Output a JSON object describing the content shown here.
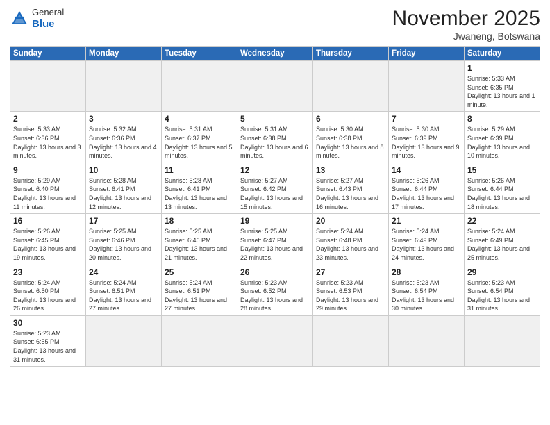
{
  "header": {
    "logo_general": "General",
    "logo_blue": "Blue",
    "month_title": "November 2025",
    "location": "Jwaneng, Botswana"
  },
  "days_of_week": [
    "Sunday",
    "Monday",
    "Tuesday",
    "Wednesday",
    "Thursday",
    "Friday",
    "Saturday"
  ],
  "weeks": [
    [
      {
        "day": "",
        "info": ""
      },
      {
        "day": "",
        "info": ""
      },
      {
        "day": "",
        "info": ""
      },
      {
        "day": "",
        "info": ""
      },
      {
        "day": "",
        "info": ""
      },
      {
        "day": "",
        "info": ""
      },
      {
        "day": "1",
        "info": "Sunrise: 5:33 AM\nSunset: 6:35 PM\nDaylight: 13 hours and 1 minute."
      }
    ],
    [
      {
        "day": "2",
        "info": "Sunrise: 5:33 AM\nSunset: 6:36 PM\nDaylight: 13 hours and 3 minutes."
      },
      {
        "day": "3",
        "info": "Sunrise: 5:32 AM\nSunset: 6:36 PM\nDaylight: 13 hours and 4 minutes."
      },
      {
        "day": "4",
        "info": "Sunrise: 5:31 AM\nSunset: 6:37 PM\nDaylight: 13 hours and 5 minutes."
      },
      {
        "day": "5",
        "info": "Sunrise: 5:31 AM\nSunset: 6:38 PM\nDaylight: 13 hours and 6 minutes."
      },
      {
        "day": "6",
        "info": "Sunrise: 5:30 AM\nSunset: 6:38 PM\nDaylight: 13 hours and 8 minutes."
      },
      {
        "day": "7",
        "info": "Sunrise: 5:30 AM\nSunset: 6:39 PM\nDaylight: 13 hours and 9 minutes."
      },
      {
        "day": "8",
        "info": "Sunrise: 5:29 AM\nSunset: 6:39 PM\nDaylight: 13 hours and 10 minutes."
      }
    ],
    [
      {
        "day": "9",
        "info": "Sunrise: 5:29 AM\nSunset: 6:40 PM\nDaylight: 13 hours and 11 minutes."
      },
      {
        "day": "10",
        "info": "Sunrise: 5:28 AM\nSunset: 6:41 PM\nDaylight: 13 hours and 12 minutes."
      },
      {
        "day": "11",
        "info": "Sunrise: 5:28 AM\nSunset: 6:41 PM\nDaylight: 13 hours and 13 minutes."
      },
      {
        "day": "12",
        "info": "Sunrise: 5:27 AM\nSunset: 6:42 PM\nDaylight: 13 hours and 15 minutes."
      },
      {
        "day": "13",
        "info": "Sunrise: 5:27 AM\nSunset: 6:43 PM\nDaylight: 13 hours and 16 minutes."
      },
      {
        "day": "14",
        "info": "Sunrise: 5:26 AM\nSunset: 6:44 PM\nDaylight: 13 hours and 17 minutes."
      },
      {
        "day": "15",
        "info": "Sunrise: 5:26 AM\nSunset: 6:44 PM\nDaylight: 13 hours and 18 minutes."
      }
    ],
    [
      {
        "day": "16",
        "info": "Sunrise: 5:26 AM\nSunset: 6:45 PM\nDaylight: 13 hours and 19 minutes."
      },
      {
        "day": "17",
        "info": "Sunrise: 5:25 AM\nSunset: 6:46 PM\nDaylight: 13 hours and 20 minutes."
      },
      {
        "day": "18",
        "info": "Sunrise: 5:25 AM\nSunset: 6:46 PM\nDaylight: 13 hours and 21 minutes."
      },
      {
        "day": "19",
        "info": "Sunrise: 5:25 AM\nSunset: 6:47 PM\nDaylight: 13 hours and 22 minutes."
      },
      {
        "day": "20",
        "info": "Sunrise: 5:24 AM\nSunset: 6:48 PM\nDaylight: 13 hours and 23 minutes."
      },
      {
        "day": "21",
        "info": "Sunrise: 5:24 AM\nSunset: 6:49 PM\nDaylight: 13 hours and 24 minutes."
      },
      {
        "day": "22",
        "info": "Sunrise: 5:24 AM\nSunset: 6:49 PM\nDaylight: 13 hours and 25 minutes."
      }
    ],
    [
      {
        "day": "23",
        "info": "Sunrise: 5:24 AM\nSunset: 6:50 PM\nDaylight: 13 hours and 26 minutes."
      },
      {
        "day": "24",
        "info": "Sunrise: 5:24 AM\nSunset: 6:51 PM\nDaylight: 13 hours and 27 minutes."
      },
      {
        "day": "25",
        "info": "Sunrise: 5:24 AM\nSunset: 6:51 PM\nDaylight: 13 hours and 27 minutes."
      },
      {
        "day": "26",
        "info": "Sunrise: 5:23 AM\nSunset: 6:52 PM\nDaylight: 13 hours and 28 minutes."
      },
      {
        "day": "27",
        "info": "Sunrise: 5:23 AM\nSunset: 6:53 PM\nDaylight: 13 hours and 29 minutes."
      },
      {
        "day": "28",
        "info": "Sunrise: 5:23 AM\nSunset: 6:54 PM\nDaylight: 13 hours and 30 minutes."
      },
      {
        "day": "29",
        "info": "Sunrise: 5:23 AM\nSunset: 6:54 PM\nDaylight: 13 hours and 31 minutes."
      }
    ],
    [
      {
        "day": "30",
        "info": "Sunrise: 5:23 AM\nSunset: 6:55 PM\nDaylight: 13 hours and 31 minutes."
      },
      {
        "day": "",
        "info": ""
      },
      {
        "day": "",
        "info": ""
      },
      {
        "day": "",
        "info": ""
      },
      {
        "day": "",
        "info": ""
      },
      {
        "day": "",
        "info": ""
      },
      {
        "day": "",
        "info": ""
      }
    ]
  ]
}
